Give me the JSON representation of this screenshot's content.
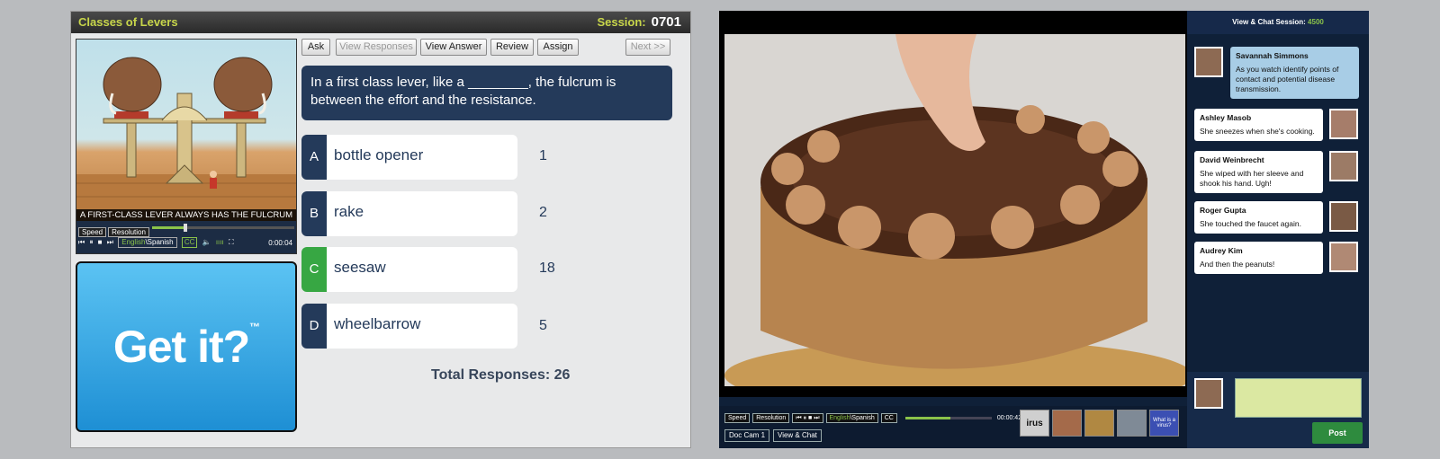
{
  "left_panel": {
    "title": "Classes of Levers",
    "session_label": "Session:",
    "session_number": "0701",
    "video": {
      "caption": "A FIRST-CLASS LEVER ALWAYS HAS THE FULCRUM",
      "speed_label": "Speed",
      "resolution_label": "Resolution",
      "lang_english": "English",
      "lang_spanish": "Spanish",
      "cc_label": "CC",
      "timecode": "0:00:04",
      "progress": 0.22
    },
    "getit": {
      "text": "Get it?",
      "tm": "™"
    },
    "toolbar": {
      "ask": "Ask",
      "view_responses": "View Responses",
      "view_answer": "View Answer",
      "review": "Review",
      "assign": "Assign",
      "next": "Next >>"
    },
    "question": "In a first class lever, like a ________, the fulcrum is between the effort and the resistance.",
    "answers": [
      {
        "letter": "A",
        "text": "bottle opener",
        "count": "1",
        "correct": false
      },
      {
        "letter": "B",
        "text": "rake",
        "count": "2",
        "correct": false
      },
      {
        "letter": "C",
        "text": "seesaw",
        "count": "18",
        "correct": true
      },
      {
        "letter": "D",
        "text": "wheelbarrow",
        "count": "5",
        "correct": false
      }
    ],
    "total_responses": "Total Responses: 26"
  },
  "right_panel": {
    "controls": {
      "speed_label": "Speed",
      "resolution_label": "Resolution",
      "lang_english": "English",
      "lang_spanish": "Spanish",
      "cc_label": "CC",
      "timecode": "00:00:42",
      "progress": 0.52,
      "doc_cam": "Doc Cam 1",
      "view_chat": "View & Chat"
    },
    "thumbnails": [
      {
        "label": "irus",
        "color": "#cfcfcf"
      },
      {
        "label": "",
        "color": "#a46a4a"
      },
      {
        "label": "",
        "color": "#b08842"
      },
      {
        "label": "",
        "color": "#7f8a96"
      },
      {
        "label": "What is a virus?",
        "color": "#3b4fb3"
      }
    ],
    "chat": {
      "header_label": "View & Chat Session:",
      "header_number": "4500",
      "messages": [
        {
          "name": "Savannah Simmons",
          "text": "As you watch identify points of contact and potential disease transmission."
        },
        {
          "name": "Ashley Masob",
          "text": "She sneezes when she's cooking."
        },
        {
          "name": "David Weinbrecht",
          "text": "She wiped with her sleeve and shook his hand. Ugh!"
        },
        {
          "name": "Roger Gupta",
          "text": "She touched the faucet again."
        },
        {
          "name": "Audrey Kim",
          "text": "And then the peanuts!"
        }
      ],
      "post_button": "Post"
    }
  }
}
